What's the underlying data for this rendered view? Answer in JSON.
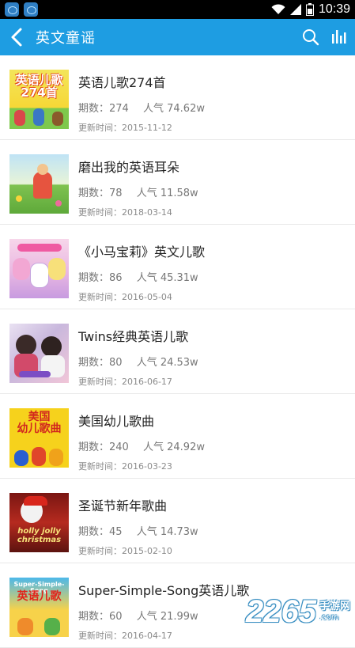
{
  "status_bar": {
    "time": "10:39",
    "icons": [
      "app-notification-icon",
      "app-notification-icon",
      "wifi-icon",
      "signal-icon",
      "battery-icon"
    ]
  },
  "header": {
    "title": "英文童谣",
    "back_icon": "back-arrow-icon",
    "search_icon": "search-icon",
    "chart_icon": "bar-chart-icon",
    "color": "#1e9de2"
  },
  "labels": {
    "issues_prefix": "期数：",
    "popularity_prefix": "人气 ",
    "update_prefix": "更新时间："
  },
  "items": [
    {
      "title": "英语儿歌274首",
      "issues": "274",
      "popularity": "74.62w",
      "updated": "2015-11-12",
      "cover_text": "英语儿歌 274首"
    },
    {
      "title": "磨出我的英语耳朵",
      "issues": "78",
      "popularity": "11.58w",
      "updated": "2018-03-14",
      "cover_text": ""
    },
    {
      "title": "《小马宝莉》英文儿歌",
      "issues": "86",
      "popularity": "45.31w",
      "updated": "2016-05-04",
      "cover_text": ""
    },
    {
      "title": "Twins经典英语儿歌",
      "issues": "80",
      "popularity": "24.53w",
      "updated": "2016-06-17",
      "cover_text": ""
    },
    {
      "title": "美国幼儿歌曲",
      "issues": "240",
      "popularity": "24.92w",
      "updated": "2016-03-23",
      "cover_text": "美国 幼儿歌曲"
    },
    {
      "title": "圣诞节新年歌曲",
      "issues": "45",
      "popularity": "14.73w",
      "updated": "2015-02-10",
      "cover_text": "holly jolly christmas"
    },
    {
      "title": "Super-Simple-Song英语儿歌",
      "issues": "60",
      "popularity": "21.99w",
      "updated": "2016-04-17",
      "cover_text": "Super-Simple-Song 英语儿歌"
    }
  ],
  "watermark": {
    "number": "2265",
    "text": "手游网",
    "domain": ".com"
  }
}
